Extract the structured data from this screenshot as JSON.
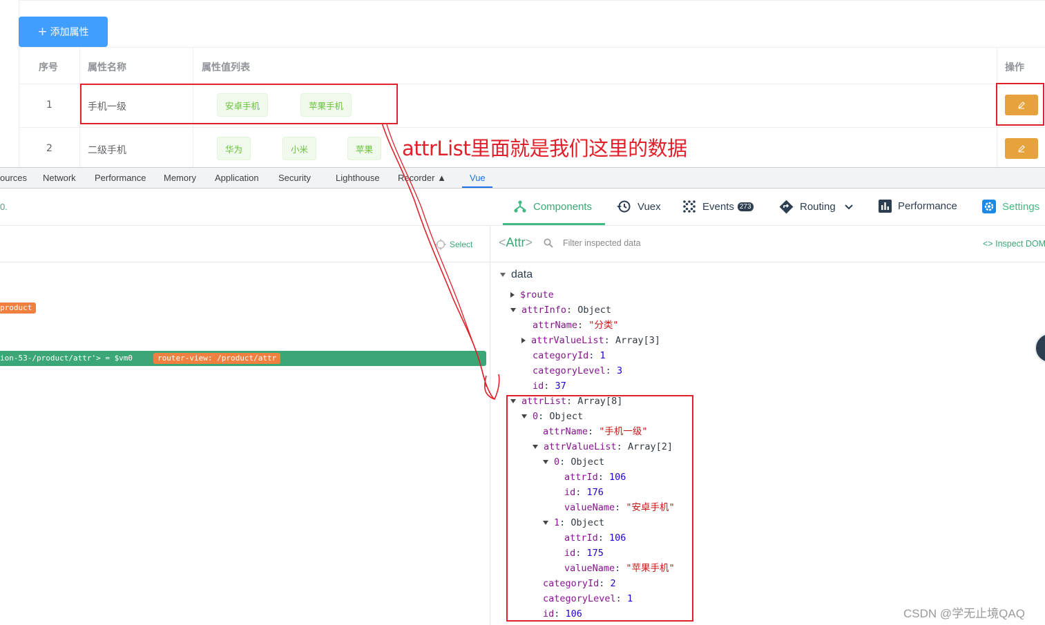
{
  "page": {
    "add_button_label": "添加属性",
    "table": {
      "headers": [
        "序号",
        "属性名称",
        "属性值列表",
        "操作"
      ],
      "rows": [
        {
          "index": "1",
          "name": "手机一级",
          "values": [
            "安卓手机",
            "苹果手机"
          ]
        },
        {
          "index": "2",
          "name": "二级手机",
          "values": [
            "华为",
            "小米",
            "苹果"
          ]
        }
      ]
    },
    "annotation": "attrList里面就是我们这里的数据"
  },
  "devtools": {
    "tabs": [
      "ources",
      "Network",
      "Performance",
      "Memory",
      "Application",
      "Security",
      "Lighthouse",
      "Recorder",
      "Vue"
    ],
    "active_tab": "Vue"
  },
  "vue": {
    "nav": [
      {
        "label": "Components",
        "icon": "components-icon",
        "active": true
      },
      {
        "label": "Vuex",
        "icon": "history-icon"
      },
      {
        "label": "Events",
        "icon": "events-icon",
        "badge": "273"
      },
      {
        "label": "Routing",
        "icon": "routing-icon"
      },
      {
        "label": "Performance",
        "icon": "performance-icon"
      },
      {
        "label": "Settings",
        "icon": "settings-icon"
      }
    ],
    "left_edge_text": "0.",
    "select_label": "Select",
    "tree": {
      "product_badge": "product",
      "selected_row": "ion-53-/product/attr'> = $vm0",
      "router_badge": "router-view: /product/attr"
    },
    "inspector": {
      "component_name": "Attr",
      "filter_placeholder": "Filter inspected data",
      "inspect_dom": "Inspect DOM",
      "section": "data",
      "lines": [
        {
          "key": "$route",
          "arrow": "right"
        },
        {
          "key": "attrInfo",
          "value": "Object",
          "vtype": "t",
          "arrow": "down"
        },
        {
          "key": "attrName",
          "value": "\"分类\"",
          "vtype": "s"
        },
        {
          "key": "attrValueList",
          "value": "Array[3]",
          "vtype": "t",
          "arrow": "right"
        },
        {
          "key": "categoryId",
          "value": "1",
          "vtype": "n"
        },
        {
          "key": "categoryLevel",
          "value": "3",
          "vtype": "n"
        },
        {
          "key": "id",
          "value": "37",
          "vtype": "n"
        },
        {
          "key": "attrList",
          "value": "Array[8]",
          "vtype": "t",
          "arrow": "down"
        },
        {
          "key": "0",
          "value": "Object",
          "vtype": "t",
          "arrow": "down"
        },
        {
          "key": "attrName",
          "value": "\"手机一级\"",
          "vtype": "s"
        },
        {
          "key": "attrValueList",
          "value": "Array[2]",
          "vtype": "t",
          "arrow": "down"
        },
        {
          "key": "0",
          "value": "Object",
          "vtype": "t",
          "arrow": "down"
        },
        {
          "key": "attrId",
          "value": "106",
          "vtype": "n"
        },
        {
          "key": "id",
          "value": "176",
          "vtype": "n"
        },
        {
          "key": "valueName",
          "value": "\"安卓手机\"",
          "vtype": "s"
        },
        {
          "key": "1",
          "value": "Object",
          "vtype": "t",
          "arrow": "down"
        },
        {
          "key": "attrId",
          "value": "106",
          "vtype": "n"
        },
        {
          "key": "id",
          "value": "175",
          "vtype": "n"
        },
        {
          "key": "valueName",
          "value": "\"苹果手机\"",
          "vtype": "s"
        },
        {
          "key": "categoryId",
          "value": "2",
          "vtype": "n"
        },
        {
          "key": "categoryLevel",
          "value": "1",
          "vtype": "n"
        },
        {
          "key": "id",
          "value": "106",
          "vtype": "n"
        }
      ]
    }
  },
  "watermark": "CSDN @学无止境QAQ",
  "colors": {
    "primary": "#409eff",
    "warning": "#e6a23c",
    "vue_green": "#42b983",
    "annotation_red": "#e0202a"
  }
}
